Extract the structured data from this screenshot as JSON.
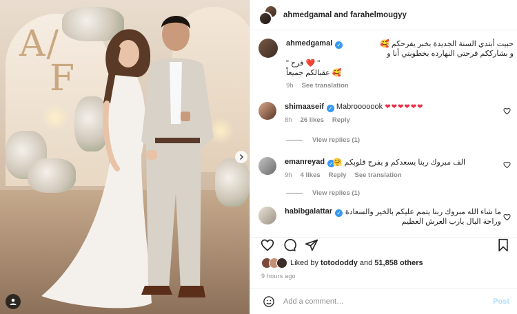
{
  "header": {
    "title": "ahmedgamal and farahelmougyy"
  },
  "caption": {
    "username": "ahmedgamal",
    "lines": [
      "حبيت أبتدي السنة الجديدة بخبر يفرحكم 🥰",
      "و بشارككم فرحتي النهارده بخطوبتي أنا و",
      "\" فرح ❤️ \"",
      "عقبالكم جميعاً 🥰"
    ],
    "time": "9h",
    "see_translation": "See translation"
  },
  "comments": [
    {
      "username": "shimaaseif",
      "text": "Mabrooooook",
      "hearts": "❤❤❤❤❤❤",
      "time": "8h",
      "likes": "26 likes",
      "reply": "Reply",
      "view_replies": "View replies (1)"
    },
    {
      "username": "emanreyad",
      "text": "الف مبروك ربنا يسعدكم و يفرح قلوبكم 🤗",
      "time": "9h",
      "likes": "4 likes",
      "reply": "Reply",
      "see_translation": "See translation",
      "view_replies": "View replies (1)"
    },
    {
      "username": "habibgalattar",
      "lines": [
        "ما شاء الله مبروك ربنا يتمم عليكم بالخير والسعادة",
        "وراحة البال يارب العرش العظيم"
      ]
    }
  ],
  "likes": {
    "prefix": "Liked by",
    "user": "totododdy",
    "and": "and",
    "count": "51,858 others"
  },
  "time_ago": "9 hours ago",
  "add_comment": {
    "placeholder": "Add a comment…",
    "post": "Post"
  },
  "colors": {
    "verified": "#3897f0",
    "heart": "#ed2b44",
    "post": "#b2dffc"
  }
}
